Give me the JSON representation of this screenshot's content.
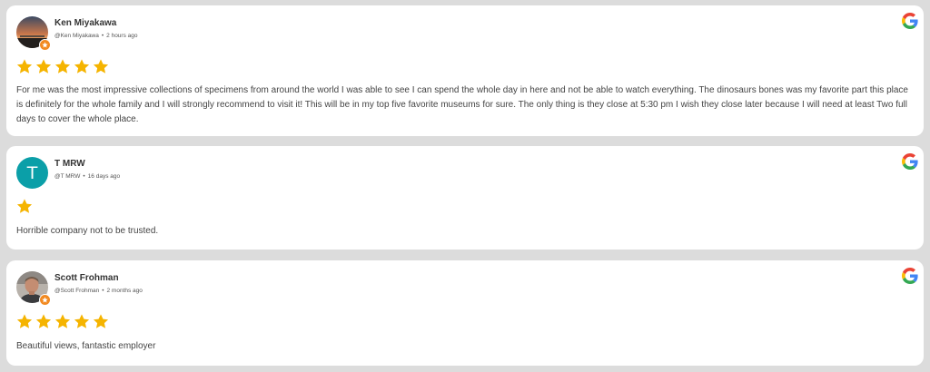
{
  "reviews": [
    {
      "name": "Ken Miyakawa",
      "handle": "@Ken Miyakawa",
      "time": "2 hours ago",
      "rating": 5,
      "text": "For me was the most impressive collections of specimens from around the world I was able to see I can spend the whole day in here and not be able to watch everything. The dinosaurs bones was my favorite part this place is definitely for the whole family and I will strongly recommend to visit it! This will be in my top five favorite museums for sure. The only thing is they close at 5:30 pm I wish they close later because I will need at least Two full days to cover the whole place.",
      "avatar": "photo",
      "avatar_badge": "local-guide"
    },
    {
      "name": "T MRW",
      "handle": "@T MRW",
      "time": "16 days ago",
      "rating": 1,
      "text": "Horrible company not to be trusted.",
      "avatar": "letter",
      "avatar_letter": "T",
      "avatar_color": "#0b9fa8"
    },
    {
      "name": "Scott Frohman",
      "handle": "@Scott Frohman",
      "time": "2 months ago",
      "rating": 5,
      "text": "Beautiful views, fantastic employer",
      "avatar": "photo",
      "avatar_badge": "local-guide"
    }
  ],
  "separator": "•",
  "source_icon": "google-icon",
  "star_color": "#f5b400",
  "badge_color": "#f28a21"
}
